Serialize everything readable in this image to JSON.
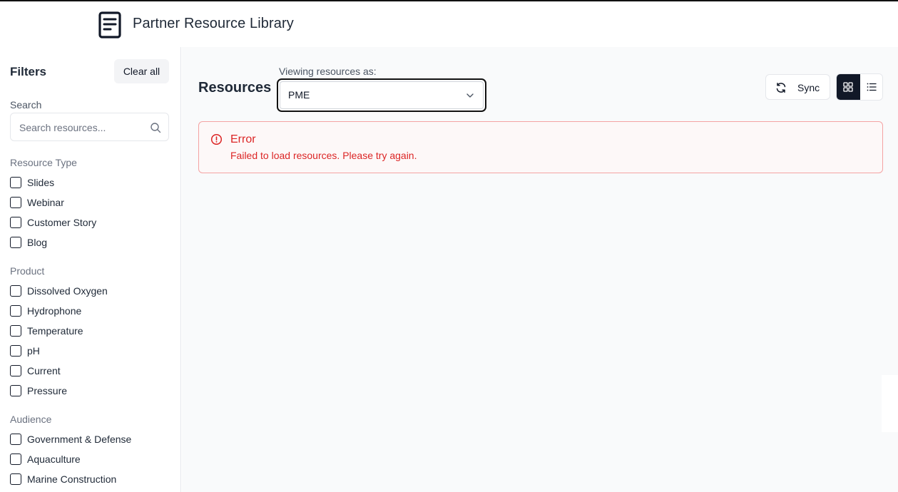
{
  "header": {
    "title": "Partner Resource Library",
    "logo_icon": "document-icon"
  },
  "sidebar": {
    "title": "Filters",
    "clear_all": "Clear all",
    "search": {
      "label": "Search",
      "placeholder": "Search resources...",
      "value": ""
    },
    "sections": [
      {
        "label": "Resource Type",
        "items": [
          "Slides",
          "Webinar",
          "Customer Story",
          "Blog"
        ]
      },
      {
        "label": "Product",
        "items": [
          "Dissolved Oxygen",
          "Hydrophone",
          "Temperature",
          "pH",
          "Current",
          "Pressure"
        ]
      },
      {
        "label": "Audience",
        "items": [
          "Government & Defense",
          "Aquaculture",
          "Marine Construction"
        ]
      }
    ]
  },
  "main": {
    "title": "Resources",
    "viewing_label": "Viewing resources as:",
    "viewing_value": "PME",
    "sync_label": "Sync",
    "view_mode": "grid",
    "error": {
      "title": "Error",
      "message": "Failed to load resources. Please try again."
    }
  },
  "colors": {
    "error": "#dc2626",
    "error_border": "#f4a3a3",
    "active_toggle": "#111827"
  }
}
